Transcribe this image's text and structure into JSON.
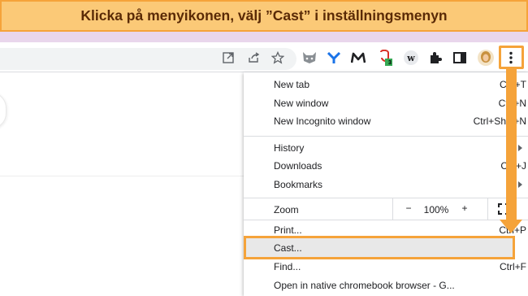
{
  "banner": {
    "text": "Klicka på menyikonen, välj ”Cast” i inställningsmenyn"
  },
  "toolbar": {
    "extensions": [
      {
        "icon": "fox-extension-icon"
      },
      {
        "icon": "y-extension-icon"
      },
      {
        "icon": "m-extension-icon"
      },
      {
        "icon": "shield-extension-icon",
        "badge": "3"
      },
      {
        "icon": "w-extension-icon",
        "label": "w"
      },
      {
        "icon": "puzzle-icon"
      },
      {
        "icon": "side-panel-icon"
      },
      {
        "icon": "profile-avatar"
      },
      {
        "icon": "kebab-menu-icon"
      }
    ]
  },
  "menu": {
    "items": {
      "new_tab": {
        "label": "New tab",
        "shortcut": "Ctrl+T"
      },
      "new_window": {
        "label": "New window",
        "shortcut": "Ctrl+N"
      },
      "new_incognito": {
        "label": "New Incognito window",
        "shortcut": "Ctrl+Shift+N"
      },
      "history": {
        "label": "History"
      },
      "downloads": {
        "label": "Downloads",
        "shortcut": "Ctrl+J"
      },
      "bookmarks": {
        "label": "Bookmarks"
      },
      "print": {
        "label": "Print...",
        "shortcut": "Ctrl+P"
      },
      "cast": {
        "label": "Cast..."
      },
      "find": {
        "label": "Find...",
        "shortcut": "Ctrl+F"
      },
      "open_native": {
        "label": "Open in native chromebook browser - G..."
      }
    },
    "zoom": {
      "label": "Zoom",
      "minus": "−",
      "value": "100%",
      "plus": "+"
    }
  },
  "colors": {
    "accent": "#f5a33a",
    "banner_bg": "#fbc977",
    "banner_text": "#5a2a06",
    "lilac": "#e9d6ec"
  }
}
